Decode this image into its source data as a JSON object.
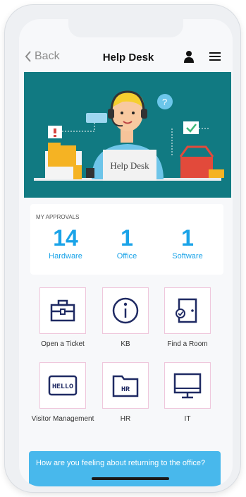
{
  "nav": {
    "back_label": "Back",
    "title": "Help Desk"
  },
  "hero": {
    "desk_sign": "Help Desk",
    "bg_color": "#117a82"
  },
  "approvals": {
    "heading": "MY APPROVALS",
    "items": [
      {
        "count": "14",
        "label": "Hardware"
      },
      {
        "count": "1",
        "label": "Office"
      },
      {
        "count": "1",
        "label": "Software"
      }
    ]
  },
  "tiles": [
    {
      "label": "Open a Ticket",
      "icon": "toolbox-icon"
    },
    {
      "label": "KB",
      "icon": "info-icon"
    },
    {
      "label": "Find a Room",
      "icon": "door-icon"
    },
    {
      "label": "Visitor Management",
      "icon": "hello-badge-icon",
      "sign": "HELLO"
    },
    {
      "label": "HR",
      "icon": "folder-icon",
      "sign": "HR"
    },
    {
      "label": "IT",
      "icon": "monitor-icon"
    }
  ],
  "banner": {
    "text": "How are you feeling about returning to the office?"
  },
  "colors": {
    "accent": "#1aa3e8",
    "banner": "#48b8ec",
    "tile_border": "#efc7dc",
    "icon_stroke": "#1f2a63"
  }
}
